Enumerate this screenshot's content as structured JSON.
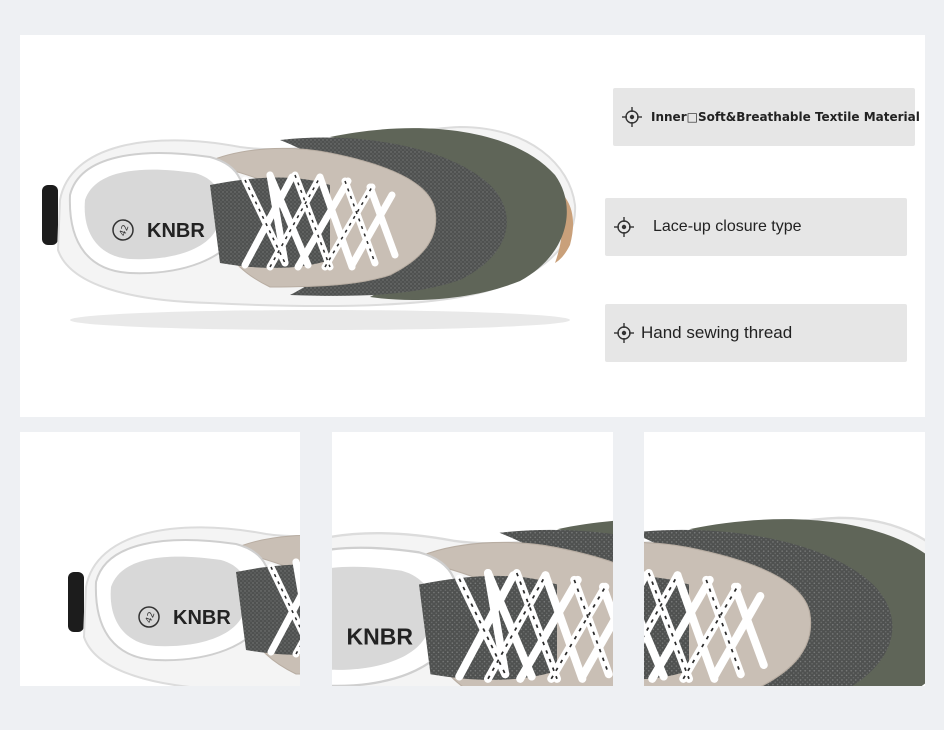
{
  "features": [
    {
      "icon": "crosshair-icon",
      "label": "Inner□Soft&Breathable Textile Material"
    },
    {
      "icon": "crosshair-icon",
      "label": "Lace-up closure type"
    },
    {
      "icon": "crosshair-icon",
      "label": "Hand sewing thread"
    }
  ],
  "shoe": {
    "brand": "KNBR",
    "size": "42",
    "colors": {
      "toe_suede": "#5f6558",
      "mesh": "#4f5150",
      "suede_panel": "#c9bfb5",
      "leather": "#f4f4f4",
      "insole": "#d8d8d8",
      "sole_accent": "#c9a07a",
      "heel_tab": "#1c1c1c"
    }
  }
}
